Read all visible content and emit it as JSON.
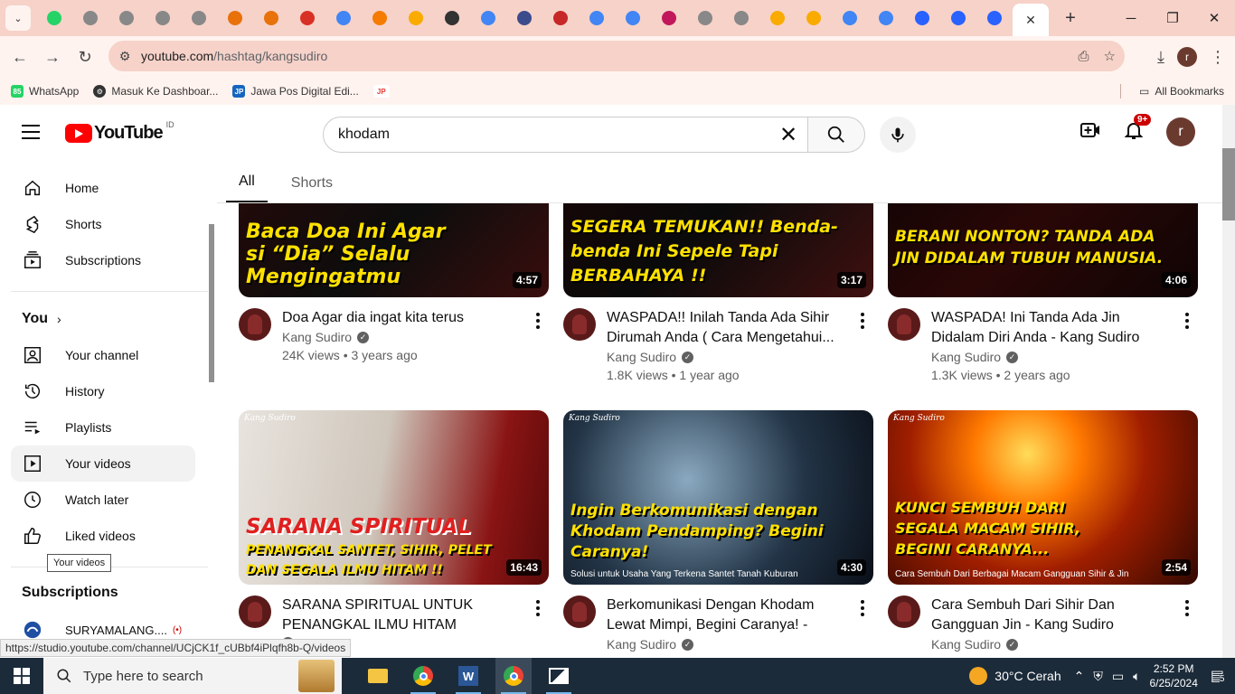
{
  "browser": {
    "address_url_host": "youtube.com",
    "address_url_path": "/hashtag/kangsudiro",
    "tab_close": "✕",
    "bookmarks": [
      {
        "label": "WhatsApp",
        "icon": "whatsapp-icon",
        "color": "#25d366"
      },
      {
        "label": "Masuk Ke Dashboar...",
        "icon": "gear-icon",
        "color": "#333333"
      },
      {
        "label": "Jawa Pos Digital Edi...",
        "icon": "jawapos-icon",
        "color": "#1565c0"
      },
      {
        "label": "",
        "icon": "jpnn-icon",
        "color": "#e53935"
      }
    ],
    "all_bookmarks": "All Bookmarks",
    "status_url": "https://studio.youtube.com/channel/UCjCK1f_cUBbf4iPlqfh8b-Q/videos"
  },
  "yt": {
    "country_code": "ID",
    "search_value": "khodam",
    "notification_count": "9+",
    "avatar_letter": "r",
    "sidebar": {
      "main": [
        {
          "label": "Home",
          "icon": "home-icon"
        },
        {
          "label": "Shorts",
          "icon": "shorts-icon"
        },
        {
          "label": "Subscriptions",
          "icon": "subscriptions-icon"
        }
      ],
      "you_title": "You",
      "you_items": [
        {
          "label": "Your channel",
          "icon": "channel-icon"
        },
        {
          "label": "History",
          "icon": "history-icon"
        },
        {
          "label": "Playlists",
          "icon": "playlists-icon"
        },
        {
          "label": "Your videos",
          "icon": "your-videos-icon"
        },
        {
          "label": "Watch later",
          "icon": "watch-later-icon"
        },
        {
          "label": "Liked videos",
          "icon": "like-icon"
        }
      ],
      "tooltip": "Your videos",
      "subs_title": "Subscriptions",
      "subs": [
        {
          "label": "SURYAMALANG....",
          "live": "(•)"
        }
      ]
    },
    "chips": [
      "All",
      "Shorts"
    ],
    "videos": [
      {
        "title": "Doa Agar dia ingat kita terus",
        "channel": "Kang Sudiro",
        "views": "24K views",
        "age": "3 years ago",
        "duration": "4:57",
        "caption": "Baca Doa Ini Agar si “Dia” Selalu Mengingatmu"
      },
      {
        "title": "WASPADA!! Inilah Tanda Ada Sihir Dirumah Anda ( Cara Mengetahui...",
        "channel": "Kang Sudiro",
        "views": "1.8K views",
        "age": "1 year ago",
        "duration": "3:17",
        "caption": "SEGERA TEMUKAN!! Benda-benda Ini Sepele Tapi BERBAHAYA !!"
      },
      {
        "title": "WASPADA! Ini Tanda Ada Jin Didalam Diri Anda - Kang Sudiro",
        "channel": "Kang Sudiro",
        "views": "1.3K views",
        "age": "2 years ago",
        "duration": "4:06",
        "caption": "BERANI NONTON? TANDA ADA JIN DIDALAM TUBUH MANUSIA."
      },
      {
        "title": "SARANA SPIRITUAL UNTUK PENANGKAL ILMU HITAM (SANTET,...",
        "channel": "Kang Sudiro",
        "views": "",
        "age": "",
        "duration": "16:43",
        "caption": "SARANA SPIRITUAL",
        "caption2": "PENANGKAL SANTET, SIHIR, PELET DAN SEGALA ILMU HITAM !!",
        "brand": "Kang Sudiro"
      },
      {
        "title": "Berkomunikasi Dengan Khodam Lewat Mimpi, Begini Caranya! - Kan...",
        "channel": "Kang Sudiro",
        "views": "",
        "age": "",
        "duration": "4:30",
        "caption": "Ingin Berkomunikasi dengan Khodam Pendamping? Begini Caranya!",
        "sub": "Solusi untuk Usaha Yang Terkena Santet Tanah Kuburan",
        "brand": "Kang Sudiro"
      },
      {
        "title": "Cara Sembuh Dari Sihir Dan Gangguan Jin - Kang Sudiro",
        "channel": "Kang Sudiro",
        "views": "",
        "age": "",
        "duration": "2:54",
        "caption": "KUNCI SEMBUH DARI SEGALA MACAM SIHIR, BEGINI CARANYA...",
        "sub": "Cara Sembuh Dari Berbagai Macam Gangguan Sihir & Jin",
        "brand": "Kang Sudiro"
      }
    ]
  },
  "taskbar": {
    "search_placeholder": "Type here to search",
    "weather": "30°C  Cerah",
    "time": "2:52 PM",
    "date": "6/25/2024",
    "notif_count": "5"
  }
}
